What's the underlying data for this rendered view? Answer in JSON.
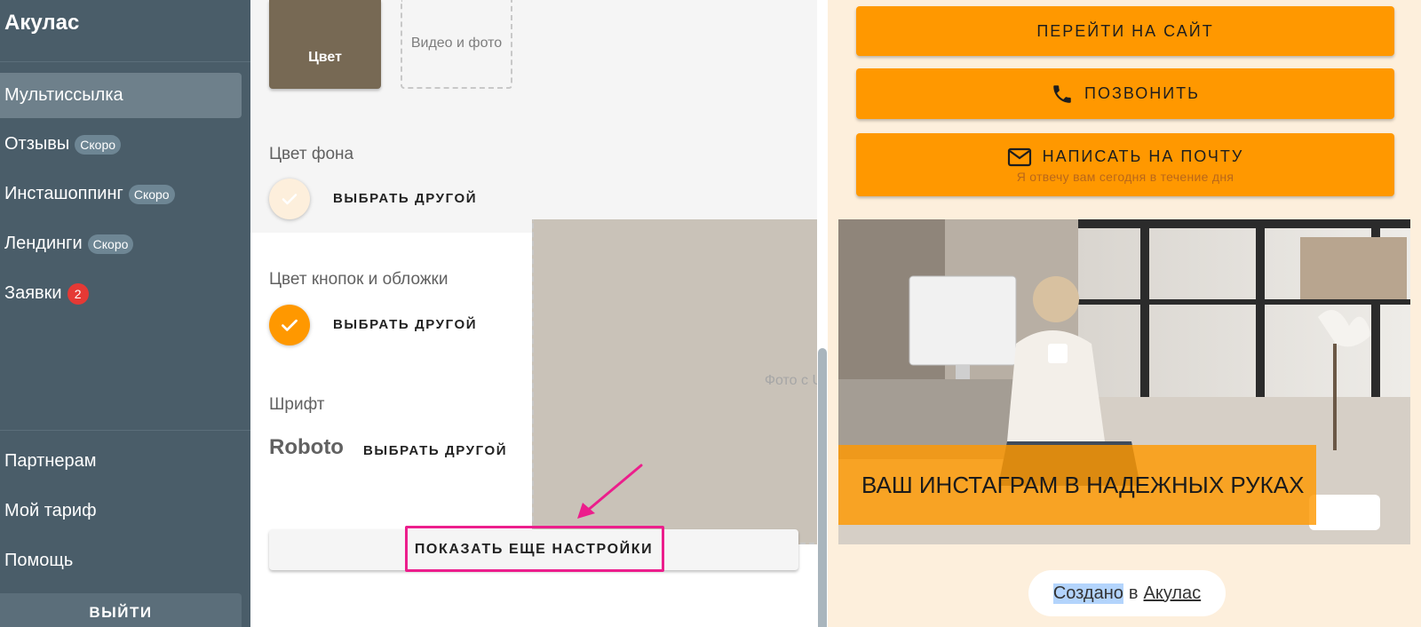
{
  "sidebar": {
    "brand": "Акулас",
    "items": [
      {
        "label": "Мультиссылка"
      },
      {
        "label": "Отзывы",
        "badge": "Скоро"
      },
      {
        "label": "Инсташоппинг",
        "badge": "Скоро"
      },
      {
        "label": "Лендинги",
        "badge": "Скоро"
      },
      {
        "label": "Заявки",
        "count": "2"
      }
    ],
    "bottom_items": [
      {
        "label": "Партнерам"
      },
      {
        "label": "Мой тариф"
      },
      {
        "label": "Помощь"
      }
    ],
    "logout_label": "ВЫЙТИ"
  },
  "settings": {
    "background_tiles": [
      {
        "label": "Цвет"
      },
      {
        "label": "Видео и фото"
      },
      {
        "label": "Фото с Unsplash"
      }
    ],
    "bg_color_label": "Цвет фона",
    "bg_color_value": "#fdefdc",
    "button_color_label": "Цвет кнопок и обложки",
    "button_color_value": "#ff9800",
    "choose_other_label": "ВЫБРАТЬ ДРУГОЙ",
    "font_label": "Шрифт",
    "font_value": "Roboto",
    "show_more_label": "ПОКАЗАТЬ ЕЩЕ НАСТРОЙКИ"
  },
  "preview": {
    "buttons": [
      {
        "label": "ПЕРЕЙТИ НА САЙТ",
        "icon": ""
      },
      {
        "label": "ПОЗВОНИТЬ",
        "icon": "phone-icon"
      },
      {
        "label": "НАПИСАТЬ НА ПОЧТУ",
        "icon": "mail-icon",
        "subtitle": "Я отвечу вам сегодня в течение дня"
      }
    ],
    "cover_title": "ВАШ ИНСТАГРАМ В НАДЕЖНЫХ РУКАХ",
    "credit_prefix": "Создано",
    "credit_in": "в",
    "credit_link": "Акулас"
  },
  "colors": {
    "sidebar": "#4a5d69",
    "accent": "#ff9800",
    "highlight": "#ec1e8c",
    "tile_color": "#776954"
  }
}
